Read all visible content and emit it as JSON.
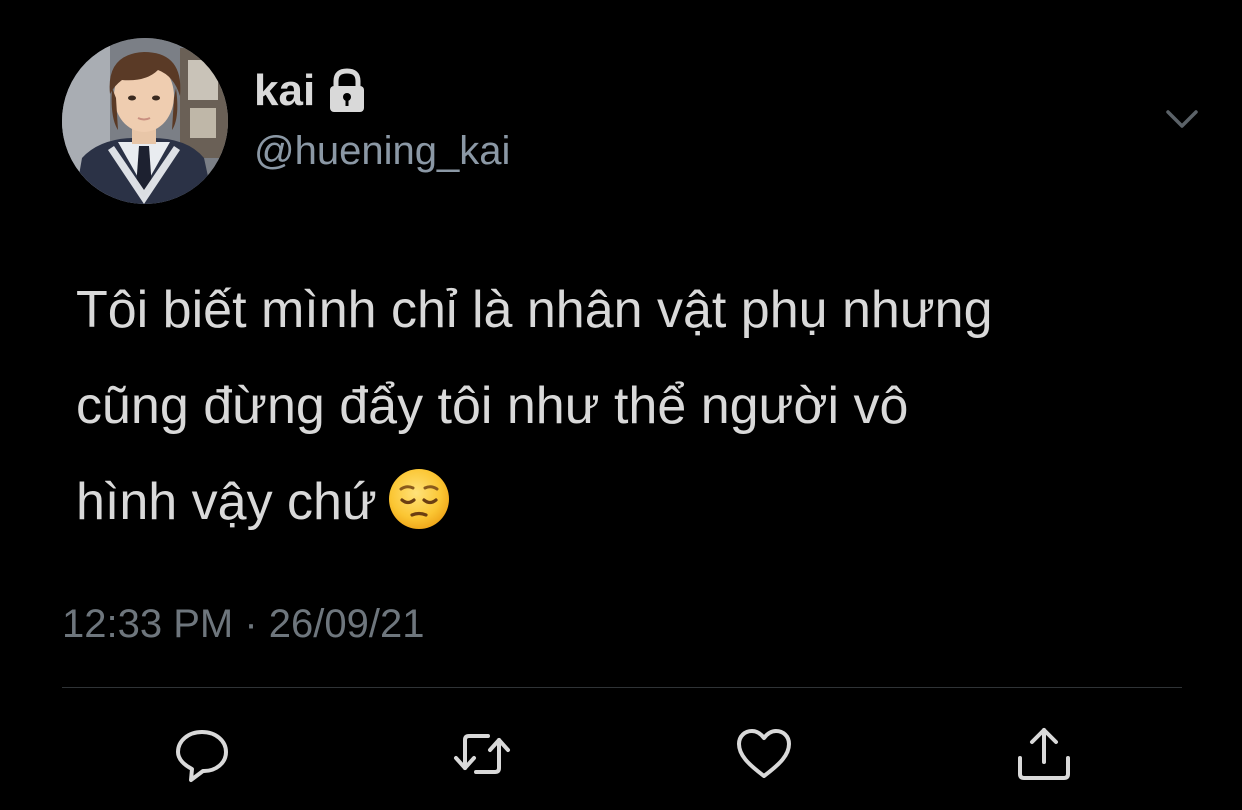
{
  "tweet": {
    "author": {
      "display_name": "kai",
      "handle": "@huening_kai",
      "protected_icon": "lock-icon",
      "avatar": "avatar"
    },
    "text_lines": [
      "Tôi biết mình chỉ là nhân vật phụ nhưng",
      "cũng đừng đẩy tôi như thể người vô",
      "hình vậy chứ"
    ],
    "emoji": "pensive-face-emoji",
    "time": "12:33 PM",
    "separator": "·",
    "date": "26/09/21"
  },
  "actions": [
    {
      "name": "reply",
      "icon": "reply-icon"
    },
    {
      "name": "retweet",
      "icon": "retweet-icon"
    },
    {
      "name": "like",
      "icon": "heart-icon"
    },
    {
      "name": "share",
      "icon": "share-icon"
    }
  ],
  "menu_icon": "chevron-down-icon",
  "colors": {
    "background": "#000000",
    "text": "#d9d9d9",
    "handle": "#8b98a5",
    "meta": "#6e767d",
    "divider": "#2f3336",
    "icon": "#d9d9d9"
  }
}
